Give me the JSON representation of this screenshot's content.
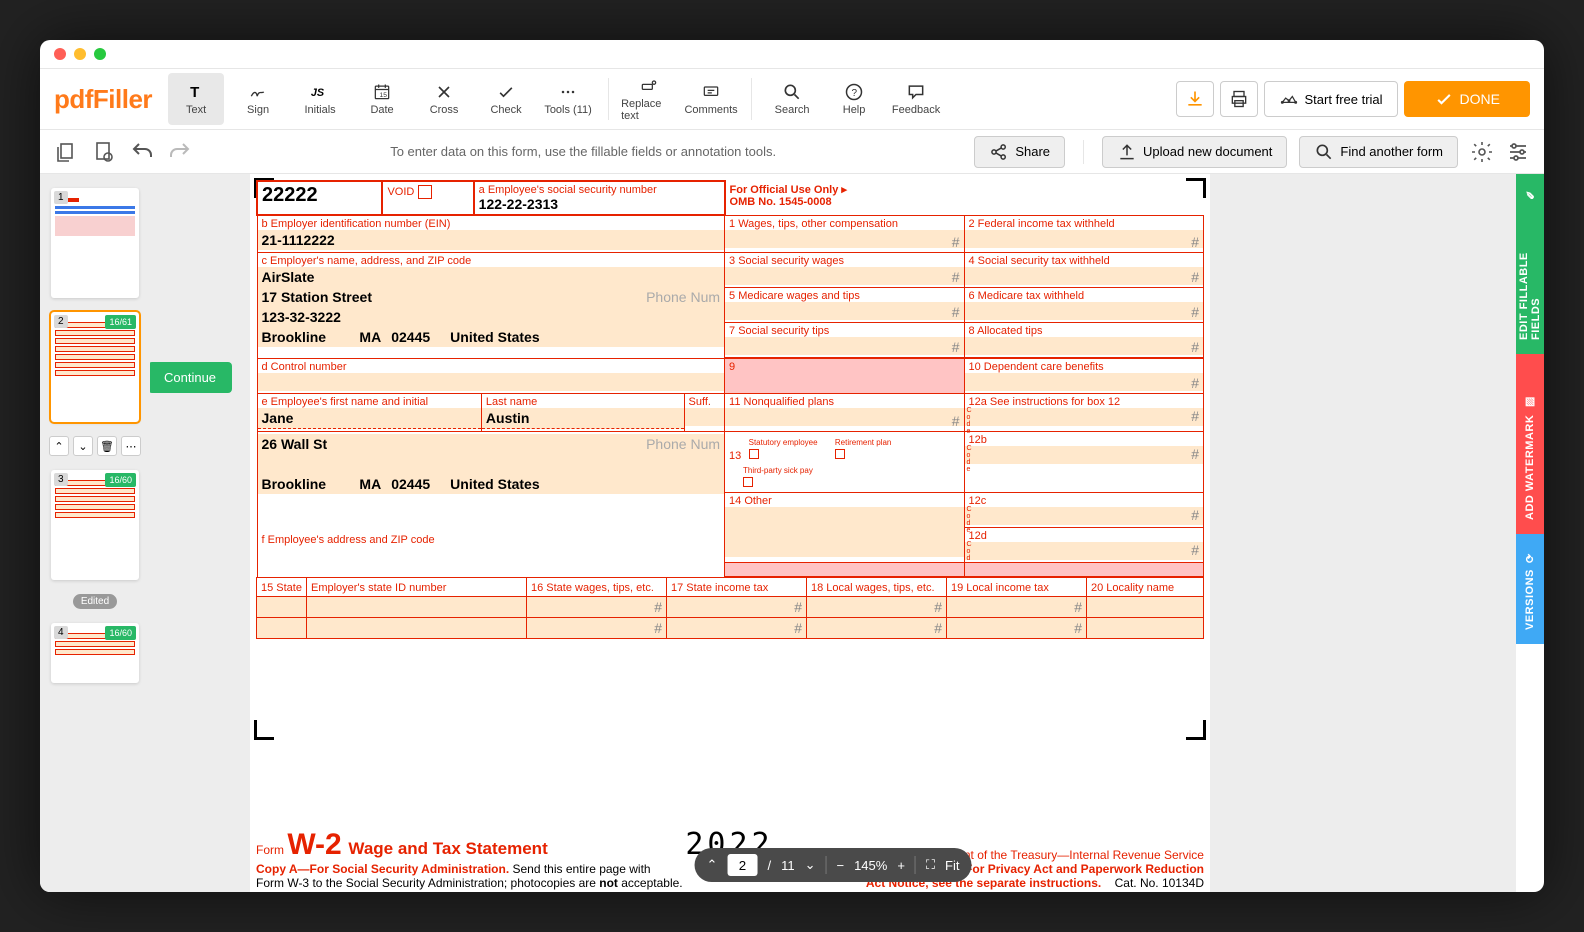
{
  "logo": "pdfFiller",
  "toolbar": [
    {
      "label": "Text"
    },
    {
      "label": "Sign"
    },
    {
      "label": "Initials"
    },
    {
      "label": "Date"
    },
    {
      "label": "Cross"
    },
    {
      "label": "Check"
    },
    {
      "label": "Tools (11)"
    }
  ],
  "toolbar2": [
    {
      "label": "Replace text"
    },
    {
      "label": "Comments"
    }
  ],
  "toolbar3": [
    {
      "label": "Search"
    },
    {
      "label": "Help"
    },
    {
      "label": "Feedback"
    }
  ],
  "cta": {
    "trial": "Start free trial",
    "done": "DONE"
  },
  "subbar": {
    "hint": "To enter data on this form, use the fillable fields or annotation tools.",
    "share": "Share",
    "upload": "Upload new document",
    "find": "Find another form"
  },
  "continue": "Continue",
  "thumbs": [
    {
      "num": "1",
      "badge": null
    },
    {
      "num": "2",
      "badge": "16/61",
      "selected": true
    },
    {
      "num": "3",
      "badge": "16/60"
    },
    {
      "num": "4",
      "badge": "16/60"
    }
  ],
  "edited": "Edited",
  "pager": {
    "current": "2",
    "total": "11",
    "zoom": "145%",
    "fit": "Fit"
  },
  "sidetabs": {
    "t1": "EDIT FILLABLE FIELDS",
    "t2": "ADD WATERMARK",
    "t3": "VERSIONS"
  },
  "w2": {
    "22222": "22222",
    "void": "VOID",
    "a_label": "a  Employee's social security number",
    "a_val": "122-22-2313",
    "official": "For Official Use Only ▸",
    "omb": "OMB No. 1545-0008",
    "b_label": "b  Employer identification number (EIN)",
    "b_val": "21-1112222",
    "c_label": "c  Employer's name, address, and ZIP code",
    "c_name": "AirSlate",
    "c_street": "17 Station Street",
    "c_zip": "123-32-3222",
    "c_city": "Brookline",
    "c_state": "MA",
    "c_postal": "02445",
    "c_country": "United States",
    "phone_ph": "Phone Num",
    "box1": "1  Wages, tips, other compensation",
    "box2": "2  Federal income tax withheld",
    "box3": "3  Social security wages",
    "box4": "4  Social security tax withheld",
    "box5": "5  Medicare wages and tips",
    "box6": "6  Medicare tax withheld",
    "box7": "7  Social security tips",
    "box8": "8  Allocated tips",
    "box9": "9",
    "box10": "10  Dependent care benefits",
    "d_label": "d  Control number",
    "e_label": "e  Employee's first name and initial",
    "e_last": "Last name",
    "e_suff": "Suff.",
    "e_first_val": "Jane",
    "e_last_val": "Austin",
    "e_street": "26 Wall St",
    "e_city": "Brookline",
    "e_state": "MA",
    "e_postal": "02445",
    "e_country": "United States",
    "box11": "11  Nonqualified plans",
    "box12a": "12a  See instructions for box 12",
    "box12b": "12b",
    "box12c": "12c",
    "box12d": "12d",
    "box13": "13",
    "stat": "Statutory employee",
    "ret": "Retirement plan",
    "sick": "Third-party sick pay",
    "box14": "14  Other",
    "f_label": "f  Employee's address and ZIP code",
    "box15": "15  State",
    "box15b": "Employer's state ID number",
    "box16": "16  State wages, tips, etc.",
    "box17": "17  State income tax",
    "box18": "18  Local wages, tips, etc.",
    "box19": "19  Local income tax",
    "box20": "20  Locality name",
    "form_word": "Form",
    "w2_title": "W-2",
    "w2_sub": "Wage and Tax Statement",
    "year": "2022",
    "copy_a": "Copy A—For Social Security Administration.",
    "copy_a2": " Send this entire page with",
    "copy_a3": "Form W-3 to the Social Security Administration; photocopies are ",
    "not": "not",
    "accept": " acceptable.",
    "dept": "Department of the Treasury—Internal Revenue Service",
    "priv1": "For Privacy Act and Paperwork Reduction",
    "priv2": "Act Notice, see the separate instructions.",
    "cat": "Cat. No. 10134D",
    "code": "Code"
  }
}
